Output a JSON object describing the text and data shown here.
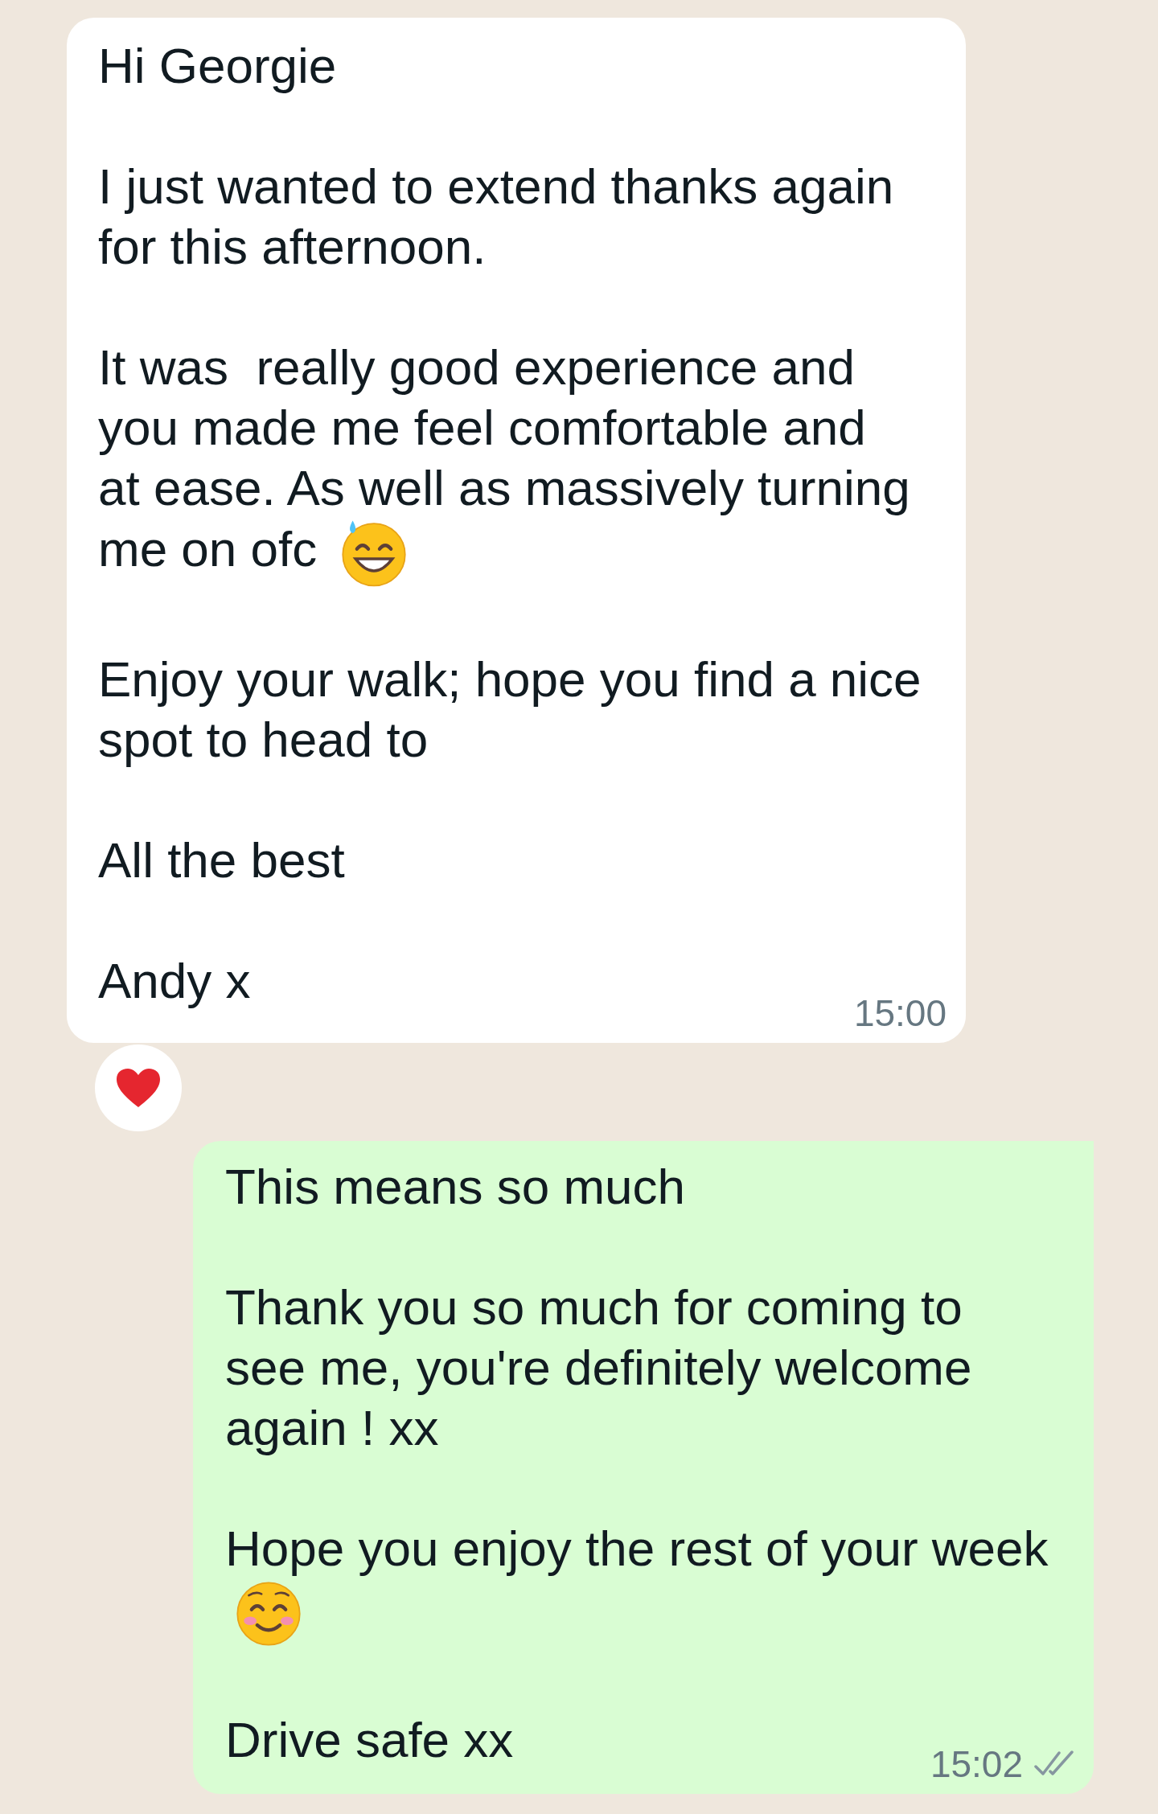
{
  "messages": [
    {
      "sent_by_me": false,
      "paragraphs": [
        {
          "kind": "plain",
          "lines": [
            "Hi Georgie"
          ]
        },
        {
          "kind": "plain",
          "lines": [
            "I just wanted to extend thanks again",
            "for this afternoon."
          ]
        },
        {
          "kind": "sweat",
          "lines": [
            "It was  really good experience and",
            "you made me feel comfortable and",
            "at ease. As well as massively turning",
            "me on ofc"
          ]
        },
        {
          "kind": "plain",
          "lines": [
            "Enjoy your walk; hope you find a nice",
            "spot to head to"
          ]
        },
        {
          "kind": "plain",
          "lines": [
            "All the best"
          ]
        },
        {
          "kind": "plain",
          "lines": [
            "Andy x"
          ]
        }
      ],
      "time": "15:00",
      "heart_reaction": true
    },
    {
      "sent_by_me": true,
      "paragraphs": [
        {
          "kind": "plain",
          "lines": [
            "This means so much"
          ]
        },
        {
          "kind": "plain",
          "lines": [
            "Thank you so much for coming to",
            "see me, you're definitely welcome",
            "again ! xx"
          ]
        },
        {
          "kind": "blush",
          "lines": [
            "Hope you enjoy the rest of your week"
          ]
        },
        {
          "kind": "plain",
          "lines": [
            "Drive safe xx"
          ]
        }
      ],
      "time": "15:02",
      "read": false
    }
  ]
}
